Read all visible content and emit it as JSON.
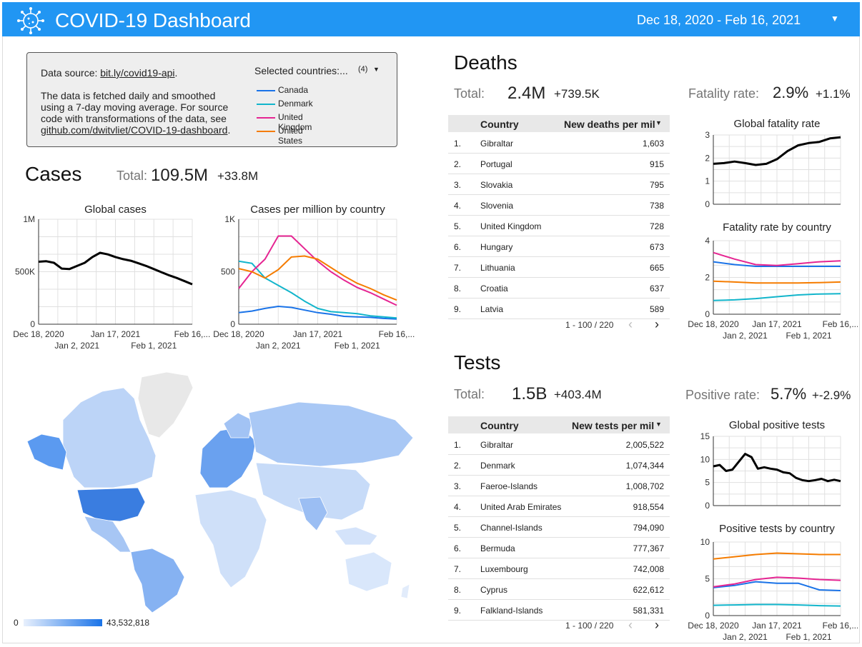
{
  "header": {
    "title": "COVID-19 Dashboard",
    "date_range": "Dec 18, 2020 - Feb 16, 2021",
    "accent": "#2196f3"
  },
  "info": {
    "source_prefix": "Data source: ",
    "source_link": "bit.ly/covid19-api",
    "source_suffix": ".",
    "line1": "The data is fetched daily and smoothed",
    "line2": "using a 7-day moving average. For source",
    "line3": "code with transformations of the data, see",
    "link2": "github.com/dwitvliet/COVID-19-dashboard",
    "link2_suffix": ".",
    "selected_title": "Selected countries:...",
    "selected_count": "(4)",
    "countries": [
      {
        "name": "Canada",
        "color": "#1a73e8"
      },
      {
        "name": "Denmark",
        "color": "#12b5cb"
      },
      {
        "name": "United Kingdom",
        "color": "#e52592"
      },
      {
        "name": "United States",
        "color": "#f57c00"
      }
    ]
  },
  "cases": {
    "title": "Cases",
    "total_label": "Total:",
    "total": "109.5M",
    "delta": "+33.8M"
  },
  "deaths": {
    "title": "Deaths",
    "total_label": "Total:",
    "total": "2.4M",
    "delta": "+739.5K",
    "rate_label": "Fatality rate:",
    "rate": "2.9%",
    "rate_delta": "+1.1%",
    "table": {
      "col1": "Country",
      "col2": "New deaths per mil",
      "rows": [
        {
          "n": "1.",
          "country": "Gibraltar",
          "value": "1,603"
        },
        {
          "n": "2.",
          "country": "Portugal",
          "value": "915"
        },
        {
          "n": "3.",
          "country": "Slovakia",
          "value": "795"
        },
        {
          "n": "4.",
          "country": "Slovenia",
          "value": "738"
        },
        {
          "n": "5.",
          "country": "United Kingdom",
          "value": "728"
        },
        {
          "n": "6.",
          "country": "Hungary",
          "value": "673"
        },
        {
          "n": "7.",
          "country": "Lithuania",
          "value": "665"
        },
        {
          "n": "8.",
          "country": "Croatia",
          "value": "637"
        },
        {
          "n": "9.",
          "country": "Latvia",
          "value": "589"
        }
      ],
      "pager": "1 - 100 / 220"
    }
  },
  "tests": {
    "title": "Tests",
    "total_label": "Total:",
    "total": "1.5B",
    "delta": "+403.4M",
    "rate_label": "Positive rate:",
    "rate": "5.7%",
    "rate_delta": "+-2.9%",
    "table": {
      "col1": "Country",
      "col2": "New tests per mil",
      "rows": [
        {
          "n": "1.",
          "country": "Gibraltar",
          "value": "2,005,522"
        },
        {
          "n": "2.",
          "country": "Denmark",
          "value": "1,074,344"
        },
        {
          "n": "3.",
          "country": "Faeroe-Islands",
          "value": "1,008,702"
        },
        {
          "n": "4.",
          "country": "United Arab Emirates",
          "value": "918,554"
        },
        {
          "n": "5.",
          "country": "Channel-Islands",
          "value": "794,090"
        },
        {
          "n": "6.",
          "country": "Bermuda",
          "value": "777,367"
        },
        {
          "n": "7.",
          "country": "Luxembourg",
          "value": "742,008"
        },
        {
          "n": "8.",
          "country": "Cyprus",
          "value": "622,612"
        },
        {
          "n": "9.",
          "country": "Falkland-Islands",
          "value": "581,331"
        }
      ],
      "pager": "1 - 100 / 220"
    }
  },
  "map": {
    "legend_min": "0",
    "legend_max": "43,532,818"
  },
  "chart_data": [
    {
      "id": "global-cases",
      "type": "line",
      "title": "Global cases",
      "yticks": [
        "1M",
        "500K",
        "0"
      ],
      "ylim": [
        0,
        1000000
      ],
      "xticks_top": [
        "Dec 18, 2020",
        "Jan 17, 2021",
        "Feb 16,..."
      ],
      "xticks_bottom": [
        "Jan 2, 2021",
        "Feb 1, 2021"
      ],
      "series": [
        {
          "color": "#000000",
          "x": [
            0,
            3,
            6,
            9,
            12,
            15,
            18,
            21,
            24,
            27,
            30,
            33,
            36,
            39,
            42,
            45,
            48,
            51,
            54,
            57,
            60
          ],
          "values": [
            595000,
            600000,
            585000,
            530000,
            525000,
            555000,
            585000,
            640000,
            680000,
            665000,
            640000,
            620000,
            605000,
            580000,
            555000,
            525000,
            495000,
            465000,
            440000,
            410000,
            380000
          ]
        }
      ]
    },
    {
      "id": "cases-by-country",
      "type": "line",
      "title": "Cases per million by country",
      "yticks": [
        "1K",
        "500",
        "0"
      ],
      "ylim": [
        0,
        1000
      ],
      "xticks_top": [
        "Dec 18, 2020",
        "Jan 17, 2021",
        "Feb 16,..."
      ],
      "xticks_bottom": [
        "Jan 2, 2021",
        "Feb 1, 2021"
      ],
      "series": [
        {
          "color": "#1a73e8",
          "x": [
            0,
            5,
            10,
            15,
            20,
            25,
            30,
            35,
            40,
            45,
            50,
            55,
            60
          ],
          "values": [
            110,
            125,
            150,
            170,
            160,
            135,
            110,
            95,
            75,
            70,
            65,
            55,
            50
          ]
        },
        {
          "color": "#12b5cb",
          "x": [
            0,
            5,
            10,
            15,
            20,
            25,
            30,
            35,
            40,
            45,
            50,
            55,
            60
          ],
          "values": [
            600,
            580,
            440,
            370,
            300,
            220,
            150,
            120,
            110,
            100,
            80,
            70,
            60
          ]
        },
        {
          "color": "#e52592",
          "x": [
            0,
            5,
            10,
            15,
            20,
            25,
            30,
            35,
            40,
            45,
            50,
            55,
            60
          ],
          "values": [
            340,
            500,
            620,
            840,
            840,
            720,
            600,
            500,
            420,
            350,
            300,
            240,
            180
          ]
        },
        {
          "color": "#f57c00",
          "x": [
            0,
            5,
            10,
            15,
            20,
            25,
            30,
            35,
            40,
            45,
            50,
            55,
            60
          ],
          "values": [
            530,
            500,
            440,
            520,
            640,
            650,
            620,
            540,
            460,
            390,
            340,
            280,
            230
          ]
        }
      ]
    },
    {
      "id": "global-fatality-rate",
      "type": "line",
      "title": "Global fatality rate",
      "yticks": [
        "3",
        "2",
        "1",
        "0"
      ],
      "ylim": [
        0,
        3
      ],
      "xticks_top": [],
      "xticks_bottom": [],
      "series": [
        {
          "color": "#000000",
          "x": [
            0,
            5,
            10,
            15,
            20,
            25,
            30,
            35,
            40,
            45,
            50,
            55,
            60
          ],
          "values": [
            1.75,
            1.78,
            1.85,
            1.78,
            1.7,
            1.75,
            1.95,
            2.3,
            2.55,
            2.65,
            2.7,
            2.85,
            2.9
          ]
        }
      ]
    },
    {
      "id": "fatality-rate-by-country",
      "type": "line",
      "title": "Fatality rate by country",
      "yticks": [
        "4",
        "2",
        "0"
      ],
      "ylim": [
        0,
        4
      ],
      "xticks_top": [
        "Dec 18, 2020",
        "Jan 17, 2021",
        "Feb 16,..."
      ],
      "xticks_bottom": [
        "Jan 2, 2021",
        "Feb 1, 2021"
      ],
      "series": [
        {
          "color": "#1a73e8",
          "x": [
            0,
            10,
            20,
            30,
            40,
            50,
            60
          ],
          "values": [
            2.85,
            2.7,
            2.6,
            2.6,
            2.6,
            2.6,
            2.6
          ]
        },
        {
          "color": "#12b5cb",
          "x": [
            0,
            10,
            20,
            30,
            40,
            50,
            60
          ],
          "values": [
            0.75,
            0.78,
            0.85,
            0.95,
            1.05,
            1.1,
            1.12
          ]
        },
        {
          "color": "#e52592",
          "x": [
            0,
            10,
            20,
            30,
            40,
            50,
            60
          ],
          "values": [
            3.35,
            3.0,
            2.7,
            2.65,
            2.75,
            2.85,
            2.9
          ]
        },
        {
          "color": "#f57c00",
          "x": [
            0,
            10,
            20,
            30,
            40,
            50,
            60
          ],
          "values": [
            1.8,
            1.75,
            1.7,
            1.7,
            1.7,
            1.72,
            1.75
          ]
        }
      ]
    },
    {
      "id": "global-positive-tests",
      "type": "line",
      "title": "Global positive tests",
      "yticks": [
        "15",
        "10",
        "5",
        "0"
      ],
      "ylim": [
        0,
        15
      ],
      "xticks_top": [],
      "xticks_bottom": [],
      "series": [
        {
          "color": "#000000",
          "x": [
            0,
            3,
            6,
            9,
            12,
            15,
            18,
            21,
            24,
            27,
            30,
            33,
            36,
            39,
            42,
            45,
            48,
            51,
            54,
            57,
            60
          ],
          "values": [
            8.5,
            8.8,
            7.5,
            7.8,
            9.5,
            11.2,
            10.5,
            8,
            8.3,
            8,
            7.8,
            7.2,
            7,
            6,
            5.5,
            5.3,
            5.5,
            5.8,
            5.3,
            5.6,
            5.3
          ]
        }
      ]
    },
    {
      "id": "positive-tests-by-country",
      "type": "line",
      "title": "Positive tests by country",
      "yticks": [
        "10",
        "5",
        "0"
      ],
      "ylim": [
        0,
        10
      ],
      "xticks_top": [
        "Dec 18, 2020",
        "Jan 17, 2021",
        "Feb 16,..."
      ],
      "xticks_bottom": [
        "Jan 2, 2021",
        "Feb 1, 2021"
      ],
      "series": [
        {
          "color": "#1a73e8",
          "x": [
            0,
            10,
            20,
            30,
            40,
            50,
            60
          ],
          "values": [
            3.8,
            4.1,
            4.6,
            4.4,
            4.4,
            3.5,
            3.4
          ]
        },
        {
          "color": "#12b5cb",
          "x": [
            0,
            10,
            20,
            30,
            40,
            50,
            60
          ],
          "values": [
            1.4,
            1.45,
            1.5,
            1.5,
            1.45,
            1.35,
            1.3
          ]
        },
        {
          "color": "#e52592",
          "x": [
            0,
            10,
            20,
            30,
            40,
            50,
            60
          ],
          "values": [
            3.9,
            4.3,
            4.9,
            5.2,
            5.1,
            4.9,
            4.8
          ]
        },
        {
          "color": "#f57c00",
          "x": [
            0,
            10,
            20,
            30,
            40,
            50,
            60
          ],
          "values": [
            7.7,
            8.0,
            8.3,
            8.5,
            8.4,
            8.3,
            8.3
          ]
        }
      ]
    }
  ]
}
